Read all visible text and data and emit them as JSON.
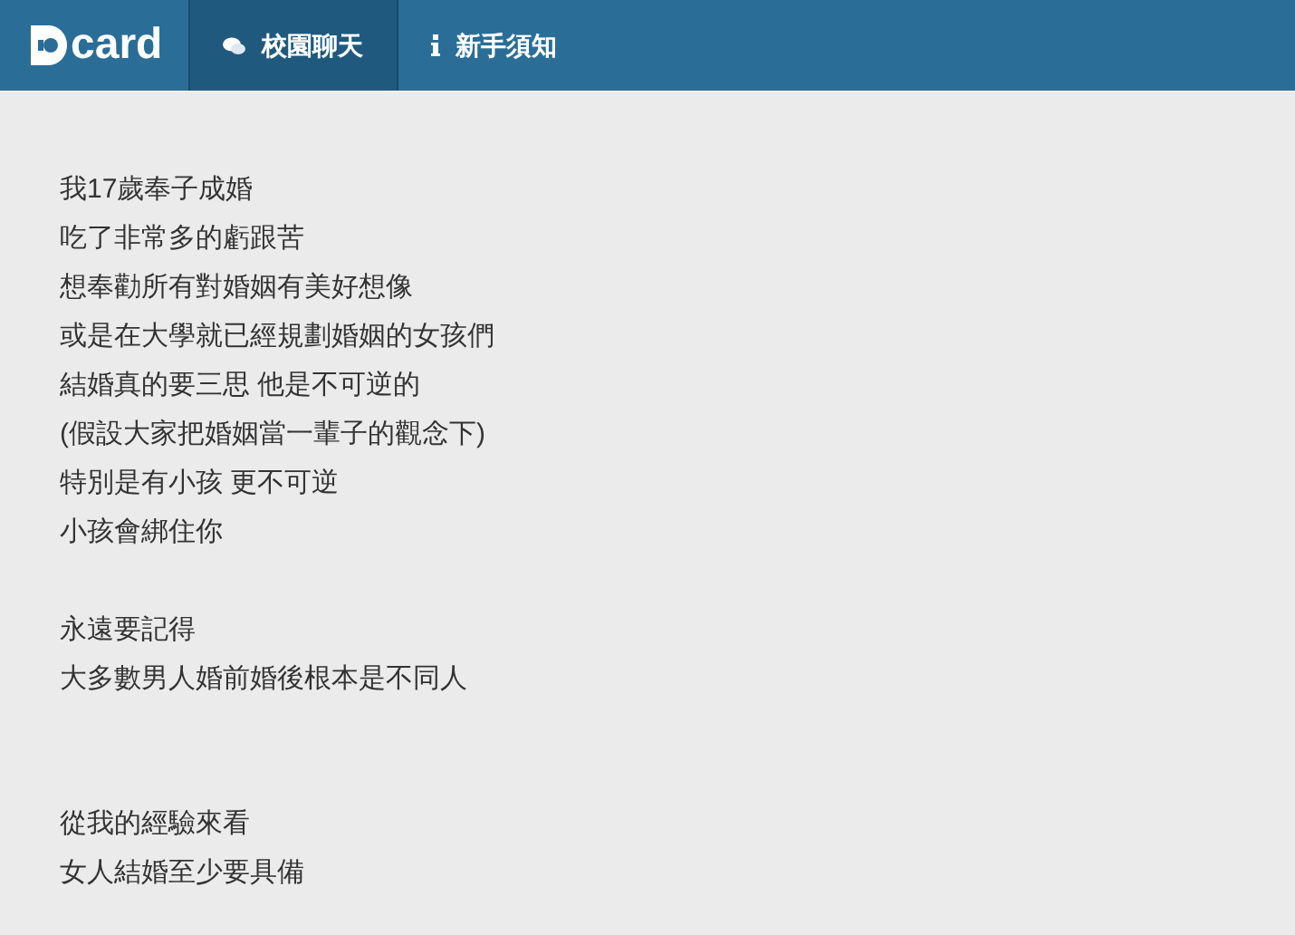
{
  "header": {
    "logo_text": "card",
    "tabs": [
      {
        "label": "校園聊天",
        "selected": true
      },
      {
        "label": "新手須知",
        "selected": false
      }
    ]
  },
  "post": {
    "paragraphs": [
      {
        "kind": "paragraph",
        "lines": [
          "我17歲奉子成婚",
          "吃了非常多的虧跟苦",
          "想奉勸所有對婚姻有美好想像",
          "或是在大學就已經規劃婚姻的女孩們",
          "結婚真的要三思 他是不可逆的",
          "(假設大家把婚姻當一輩子的觀念下)",
          "特別是有小孩 更不可逆",
          "小孩會綁住你"
        ]
      },
      {
        "kind": "paragraph",
        "lines": [
          "永遠要記得",
          "大多數男人婚前婚後根本是不同人"
        ]
      },
      {
        "kind": "section",
        "lines": [
          "從我的經驗來看",
          "女人結婚至少要具備"
        ]
      }
    ]
  }
}
